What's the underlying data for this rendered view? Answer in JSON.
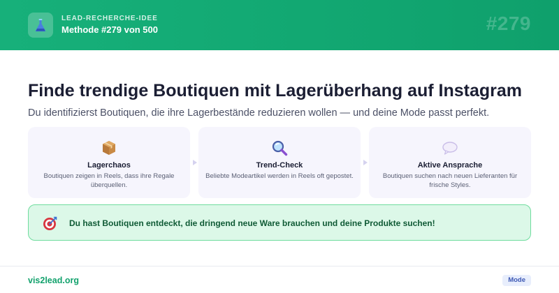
{
  "header": {
    "kicker": "LEAD-RECHERCHE-IDEE",
    "method": "Methode #279 von 500",
    "number": "#279"
  },
  "main": {
    "title": "Finde trendige Boutiquen mit Lagerüberhang auf Instagram",
    "subtitle": "Du identifizierst Boutiquen, die ihre Lagerbestände reduzieren wollen — und deine Mode passt perfekt."
  },
  "cards": [
    {
      "icon": "package-icon",
      "title": "Lagerchaos",
      "desc": "Boutiquen zeigen in Reels, dass ihre Regale überquellen."
    },
    {
      "icon": "magnifier-icon",
      "title": "Trend-Check",
      "desc": "Beliebte Modeartikel werden in Reels oft gepostet."
    },
    {
      "icon": "speech-bubble-icon",
      "title": "Aktive Ansprache",
      "desc": "Boutiquen suchen nach neuen Lieferanten für frische Styles."
    }
  ],
  "callout": {
    "icon": "target-icon",
    "text": "Du hast Boutiquen entdeckt, die dringend neue Ware brauchen und deine Produkte suchen!"
  },
  "footer": {
    "site": "vis2lead.org",
    "tag": "Mode"
  },
  "colors": {
    "header_green": "#13a872",
    "callout_bg": "#dcf8e8",
    "callout_border": "#6fdc9e",
    "card_bg": "#f6f5fd",
    "tag_text": "#3d58b4"
  }
}
